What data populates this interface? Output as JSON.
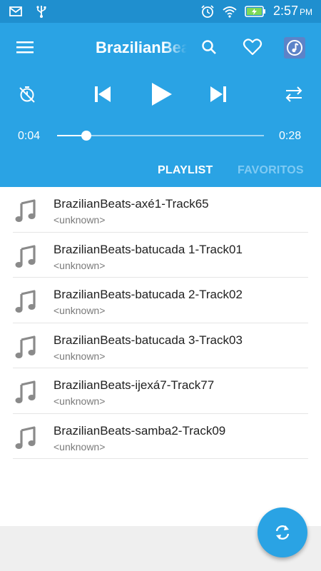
{
  "status_bar": {
    "time": "2:57",
    "ampm": "PM",
    "icons": [
      "mail-icon",
      "usb-icon",
      "alarm-icon",
      "wifi-icon",
      "battery-charging-icon"
    ]
  },
  "header": {
    "title": "BrazilianBeats"
  },
  "player": {
    "elapsed": "0:04",
    "total": "0:28",
    "progress_fraction": 0.14
  },
  "tabs": [
    {
      "label": "PLAYLIST",
      "active": true
    },
    {
      "label": "FAVORITOS",
      "active": false
    }
  ],
  "tracks": [
    {
      "title": "BrazilianBeats-axé1-Track65",
      "artist": "<unknown>"
    },
    {
      "title": "BrazilianBeats-batucada 1-Track01",
      "artist": "<unknown>"
    },
    {
      "title": "BrazilianBeats-batucada 2-Track02",
      "artist": "<unknown>"
    },
    {
      "title": "BrazilianBeats-batucada 3-Track03",
      "artist": "<unknown>"
    },
    {
      "title": "BrazilianBeats-ijexá7-Track77",
      "artist": "<unknown>"
    },
    {
      "title": "BrazilianBeats-samba2-Track09",
      "artist": "<unknown>"
    }
  ],
  "colors": {
    "primary": "#2aa3e4",
    "status_bar": "#1f8fcf",
    "tab_inactive": "#7fcaf3"
  }
}
